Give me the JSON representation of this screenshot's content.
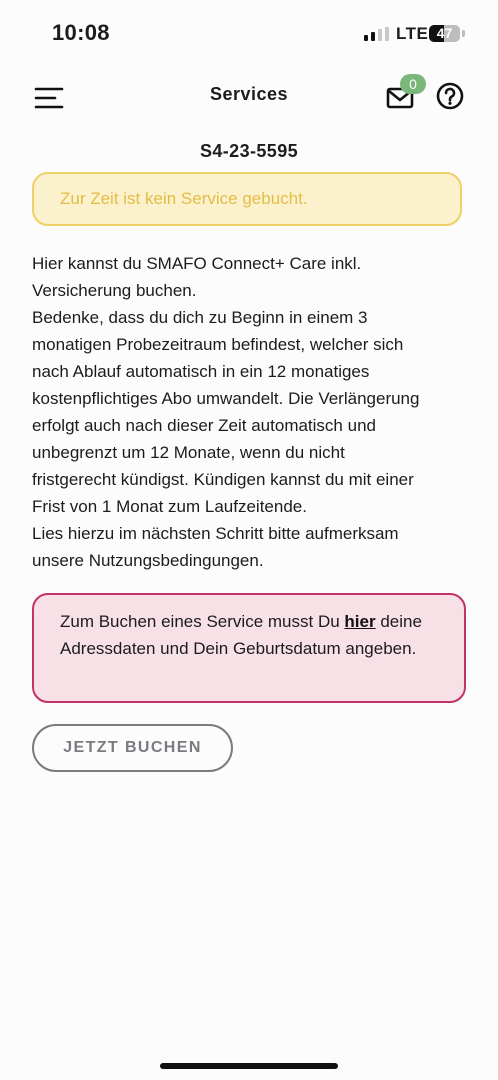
{
  "status_bar": {
    "time": "10:08",
    "network": "LTE",
    "battery": "47",
    "battery_level": 0.47,
    "signal_bars_active": 2,
    "signal_bars_total": 4
  },
  "header": {
    "title": "Services",
    "menu_icon": "hamburger-menu-icon",
    "mail_icon": "mail-icon",
    "mail_badge": "0",
    "help_icon": "question-circle-icon"
  },
  "device": {
    "id": "S4-23-5595"
  },
  "status_notice": {
    "text": "Zur Zeit ist kein Service gebucht.",
    "color": "#e3bd45"
  },
  "description": "Hier kannst du SMAFO Connect+ Care inkl.\nVersicherung buchen.\nBedenke, dass du dich zu Beginn in einem 3\nmonatigen Probezeitraum befindest, welcher sich\nnach Ablauf automatisch in ein 12 monatiges\nkostenpflichtiges Abo umwandelt. Die Verlängerung\nerfolgt auch nach dieser Zeit automatisch und\nunbegrenzt um 12 Monate, wenn du nicht\nfristgerecht kündigst. Kündigen kannst du mit einer\nFrist von 1 Monat zum Laufzeitende.\nLies hierzu im nächsten Schritt bitte aufmerksam\nunsere Nutzungsbedingungen.",
  "address_notice": {
    "text_before": "Zum Buchen eines Service musst Du ",
    "link": "hier",
    "text_after": "deine Adressdaten und Dein Geburtsdatum angeben.",
    "border_color": "#c2326a"
  },
  "book_button": {
    "label": "JETZT BUCHEN"
  }
}
